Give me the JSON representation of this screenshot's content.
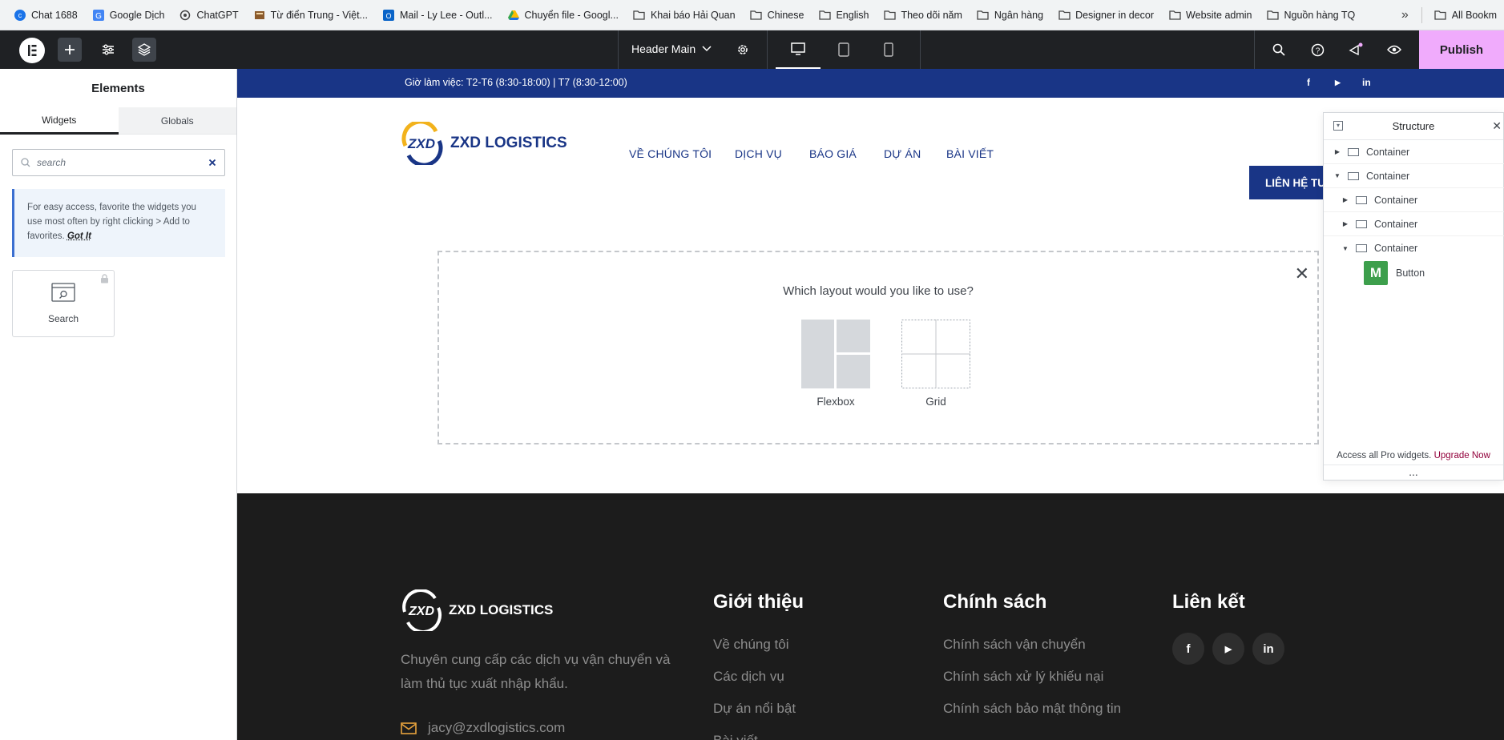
{
  "bookmarks": [
    {
      "label": "Chat 1688",
      "icon": "chat-icon"
    },
    {
      "label": "Google Dịch",
      "icon": "translate-icon"
    },
    {
      "label": "ChatGPT",
      "icon": "chatgpt-icon"
    },
    {
      "label": "Từ điển Trung - Việt...",
      "icon": "dictionary-icon"
    },
    {
      "label": "Mail - Ly Lee - Outl...",
      "icon": "outlook-icon"
    },
    {
      "label": "Chuyển file - Googl...",
      "icon": "drive-icon"
    },
    {
      "label": "Khai báo Hải Quan",
      "icon": "folder-icon"
    },
    {
      "label": "Chinese",
      "icon": "folder-icon"
    },
    {
      "label": "English",
      "icon": "folder-icon"
    },
    {
      "label": "Theo dõi năm",
      "icon": "folder-icon"
    },
    {
      "label": "Ngân hàng",
      "icon": "folder-icon"
    },
    {
      "label": "Designer in decor",
      "icon": "folder-icon"
    },
    {
      "label": "Website admin",
      "icon": "folder-icon"
    },
    {
      "label": "Nguồn hàng TQ",
      "icon": "folder-icon"
    }
  ],
  "bookmarks_more": "»",
  "all_bookmarks": "All Bookm",
  "topbar": {
    "document_name": "Header Main",
    "publish_label": "Publish"
  },
  "panel": {
    "title": "Elements",
    "tabs": [
      "Widgets",
      "Globals"
    ],
    "search_value": "search",
    "tip_text": "For easy access, favorite the widgets you use most often by right clicking > Add to favorites.",
    "tip_link": "Got It",
    "widget_label": "Search"
  },
  "site": {
    "hours": "Giờ làm việc: T2-T6 (8:30-18:00)  |  T7 (8:30-12:00)",
    "social_top": [
      "f",
      "▶",
      "in"
    ],
    "logo_text": "ZXD LOGISTICS",
    "nav": [
      "VỀ CHÚNG TÔI",
      "DỊCH VỤ",
      "BÁO GIÁ",
      "DỰ ÁN",
      "BÀI VIẾT"
    ],
    "cta": "LIÊN HỆ TƯ VẤN"
  },
  "layout_picker": {
    "question": "Which layout would you like to use?",
    "options": [
      "Flexbox",
      "Grid"
    ]
  },
  "footer": {
    "logo_text": "ZXD LOGISTICS",
    "description": "Chuyên cung cấp các dịch vụ vận chuyển và làm thủ tục xuất nhập khẩu.",
    "email": "jacy@zxdlogistics.com",
    "col1_title": "Giới thiệu",
    "col1_links": [
      "Về chúng tôi",
      "Các dịch vụ",
      "Dự án nổi bật",
      "Bài viết"
    ],
    "col2_title": "Chính sách",
    "col2_links": [
      "Chính sách vận chuyển",
      "Chính sách xử lý khiếu nại",
      "Chính sách bảo mật thông tin"
    ],
    "col3_title": "Liên kết",
    "social": [
      "f",
      "▶",
      "in"
    ]
  },
  "structure": {
    "title": "Structure",
    "items": [
      "Container",
      "Container",
      "Container",
      "Container",
      "Container",
      "Button"
    ],
    "footer_text": "Access all Pro widgets.",
    "footer_link": "Upgrade Now",
    "more": "..."
  },
  "colors": {
    "brand_blue": "#193586",
    "publish_pink": "#f0abfc",
    "footer_bg": "#1c1c1c",
    "editor_dark": "#1f2124",
    "email_icon": "#e8a33d",
    "logo_accent": "#f2b21c"
  }
}
